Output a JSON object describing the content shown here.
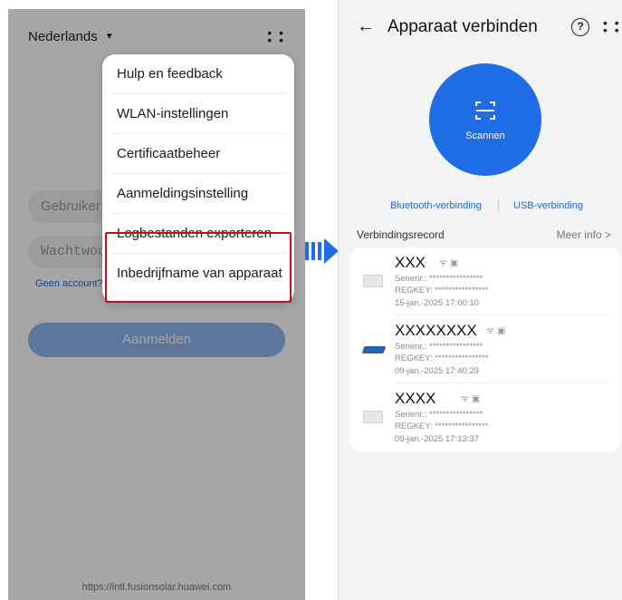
{
  "left_screen": {
    "language": "Nederlands",
    "username_placeholder": "Gebruiker",
    "password_placeholder": "Wachtwoo",
    "no_account_link": "Geen account?",
    "login_button": "Aanmelden",
    "url": "https://intl.fusionsolar.huawei.com",
    "menu": [
      {
        "label": "Hulp en feedback"
      },
      {
        "label": "WLAN-instellingen"
      },
      {
        "label": "Certificaatbeheer"
      },
      {
        "label": "Aanmeldingsinstelling"
      },
      {
        "label": "Logbestanden exporteren"
      },
      {
        "label": "Inbedrijfname van apparaat"
      }
    ],
    "highlight_color": "#b5161c"
  },
  "right_screen": {
    "title": "Apparaat verbinden",
    "help_icon_text": "?",
    "scan_label": "Scannen",
    "bluetooth_link": "Bluetooth-verbinding",
    "usb_link": "USB-verbinding",
    "records_title": "Verbindingsrecord",
    "more_info": "Meer info",
    "records": [
      {
        "name": "XXX",
        "serial": "Serienr.: ****************",
        "regkey": "REGKEY: ****************",
        "date": "15-jan.-2025 17:00:10",
        "icon": "inverter-icon"
      },
      {
        "name": "XXXXXXXX",
        "serial": "Serienr.: ****************",
        "regkey": "REGKEY: ****************",
        "date": "09-jan.-2025 17:40:29",
        "icon": "solar-panel-icon"
      },
      {
        "name": "XXXX",
        "serial": "Serienr.: ****************",
        "regkey": "REGKEY: ****************",
        "date": "09-jan.-2025 17:13:37",
        "icon": "inverter-icon"
      }
    ],
    "accent_color": "#1e6de6"
  }
}
